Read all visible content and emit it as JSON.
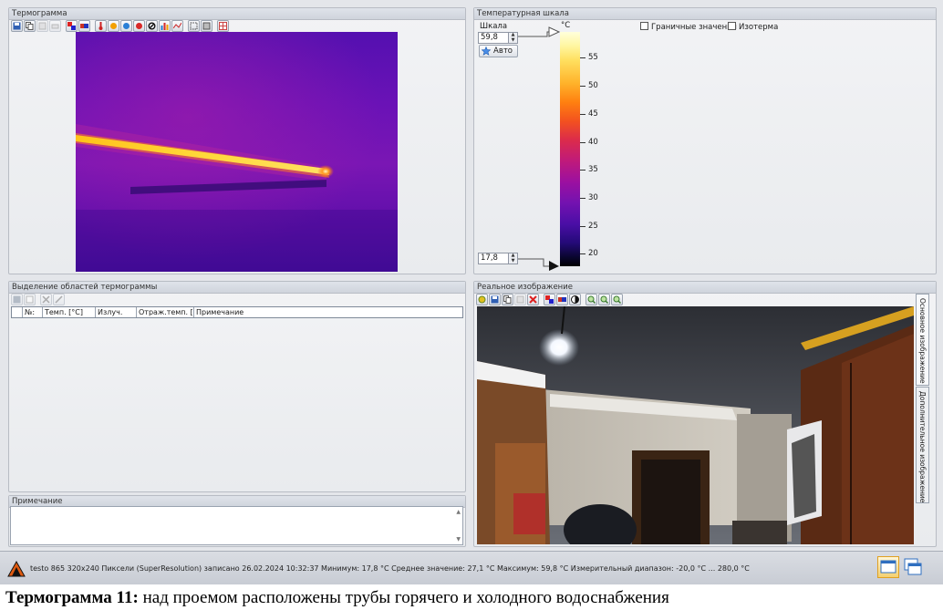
{
  "thermogram_panel": {
    "title": "Термограмма"
  },
  "scale_panel": {
    "title": "Температурная шкала",
    "scale_label": "Шкала",
    "max_value": "59,8",
    "min_value": "17,8",
    "auto_button": "Авто",
    "unit": "°C",
    "boundary_values_label": "Граничные значения",
    "isotherm_label": "Изотерма",
    "ticks": [
      "55",
      "50",
      "45",
      "40",
      "35",
      "30",
      "25",
      "20"
    ]
  },
  "regions_panel": {
    "title": "Выделение областей термограммы",
    "columns": [
      "№:",
      "Темп. [°C]",
      "Излуч.",
      "Отраж.темп. [°",
      "Примечание"
    ]
  },
  "note_panel": {
    "title": "Примечание"
  },
  "real_image_panel": {
    "title": "Реальное изображение",
    "tabs": [
      "Основное изображение",
      "Дополнительное изображение"
    ]
  },
  "status": {
    "text": "testo 865 320x240 Пиксели (SuperResolution) записано 26.02.2024 10:32:37 Минимум: 17,8 °C Среднее значение: 27,1 °C Максимум: 59,8 °C Измерительный диапазон: -20,0 °C ... 280,0 °C"
  },
  "caption": {
    "label": "Термограмма 11:",
    "text": " над проемом расположены трубы горячего и холодного водоснабжения"
  },
  "colors": {
    "panel_bg": "#e9ebee",
    "title_bg": "#d5dae2",
    "thermo_hot": "#ffd21e",
    "thermo_cold": "#4a0ea6"
  }
}
